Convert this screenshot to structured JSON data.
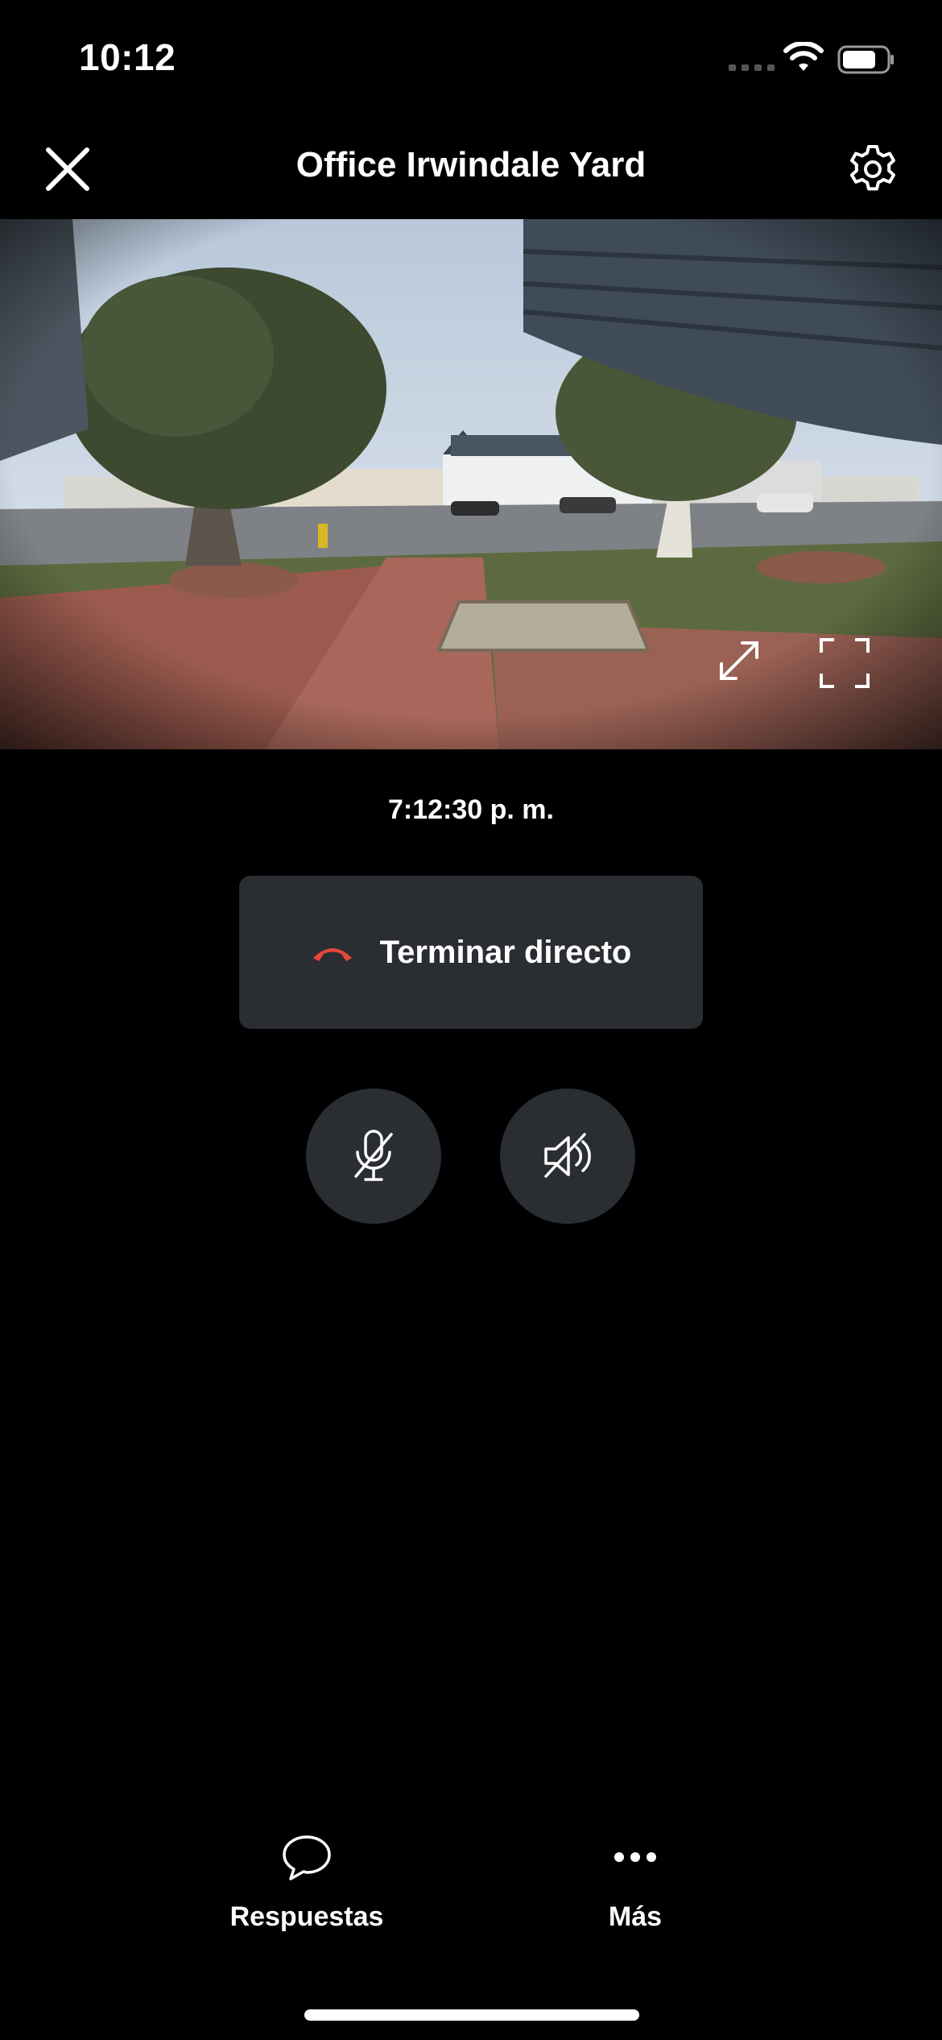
{
  "status_bar": {
    "time": "10:12",
    "signal_icon": "cellular-dots-icon",
    "wifi_icon": "wifi-icon",
    "battery_icon": "battery-icon"
  },
  "header": {
    "title": "Office Irwindale Yard",
    "close_icon": "close-icon",
    "settings_icon": "gear-icon"
  },
  "camera": {
    "expand_icon": "expand-arrows-icon",
    "fullscreen_icon": "fullscreen-icon"
  },
  "stream": {
    "time": "7:12:30 p. m."
  },
  "end_live": {
    "label": "Terminar directo",
    "icon": "hang-up-icon",
    "icon_color": "#e8473b"
  },
  "controls": {
    "mic_icon": "mic-muted-icon",
    "speaker_icon": "speaker-muted-icon"
  },
  "bottom_bar": {
    "replies_label": "Respuestas",
    "replies_icon": "chat-bubble-icon",
    "more_label": "Más",
    "more_icon": "more-dots-icon"
  },
  "colors": {
    "background": "#000000",
    "button_bg": "#2a2d31",
    "accent_red": "#e8473b"
  }
}
